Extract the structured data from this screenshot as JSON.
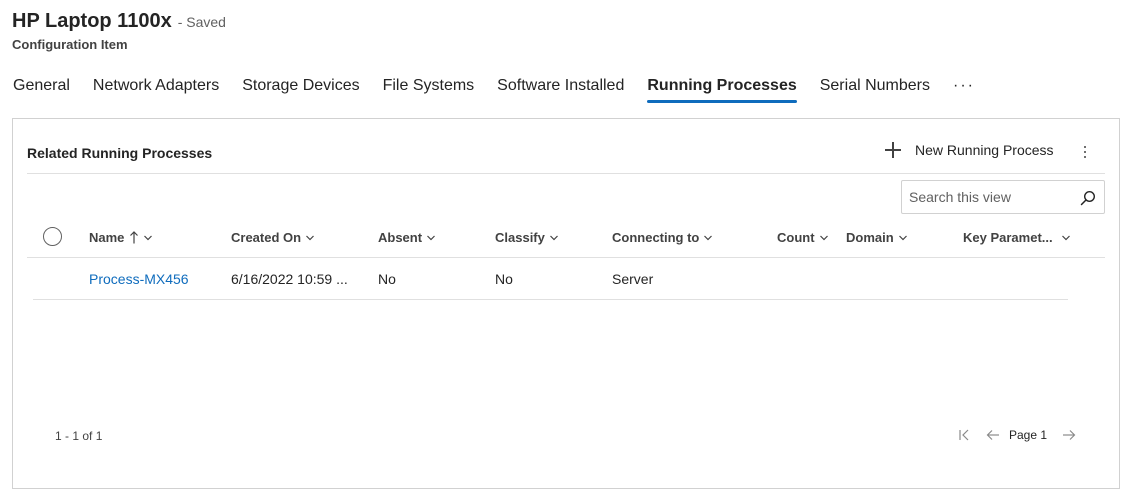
{
  "record": {
    "title": "HP Laptop 1100x",
    "status": "- Saved",
    "entity": "Configuration Item"
  },
  "tabs": [
    {
      "label": "General",
      "active": false
    },
    {
      "label": "Network Adapters",
      "active": false
    },
    {
      "label": "Storage Devices",
      "active": false
    },
    {
      "label": "File Systems",
      "active": false
    },
    {
      "label": "Software Installed",
      "active": false
    },
    {
      "label": "Running Processes",
      "active": true
    },
    {
      "label": "Serial Numbers",
      "active": false
    }
  ],
  "tabs_more": "···",
  "subgrid": {
    "title": "Related Running Processes",
    "new_label": "New Running Process",
    "search_placeholder": "Search this view"
  },
  "columns": {
    "name": "Name",
    "created_on": "Created On",
    "absent": "Absent",
    "classify": "Classify",
    "connecting_to": "Connecting to",
    "count": "Count",
    "domain": "Domain",
    "key_params": "Key Paramet..."
  },
  "rows": [
    {
      "name": "Process-MX456",
      "created_on": "6/16/2022 10:59 ...",
      "absent": "No",
      "classify": "No",
      "connecting_to": "Server",
      "count": "",
      "domain": "",
      "key_params": ""
    }
  ],
  "footer": {
    "count": "1 - 1 of 1",
    "page": "Page 1"
  },
  "colors": {
    "accent": "#0f6cbd",
    "text": "#242424",
    "border": "#d1d1d1"
  }
}
